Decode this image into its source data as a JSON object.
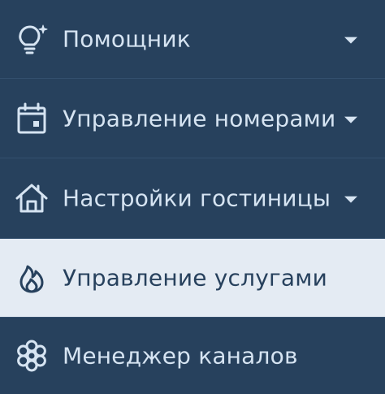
{
  "colors": {
    "background": "#27415d",
    "active_background": "#e4ebf3",
    "text": "#d6e4f2",
    "active_text": "#27415d"
  },
  "menu": {
    "items": [
      {
        "label": "Помощник",
        "icon": "lightbulb-sparkle-icon",
        "expandable": true,
        "active": false
      },
      {
        "label": "Управление номерами",
        "icon": "calendar-icon",
        "expandable": true,
        "active": false
      },
      {
        "label": "Настройки гостиницы",
        "icon": "home-icon",
        "expandable": true,
        "active": false
      },
      {
        "label": "Управление услугами",
        "icon": "flame-icon",
        "expandable": false,
        "active": true
      },
      {
        "label": "Менеджер каналов",
        "icon": "network-flower-icon",
        "expandable": false,
        "active": false
      }
    ]
  }
}
